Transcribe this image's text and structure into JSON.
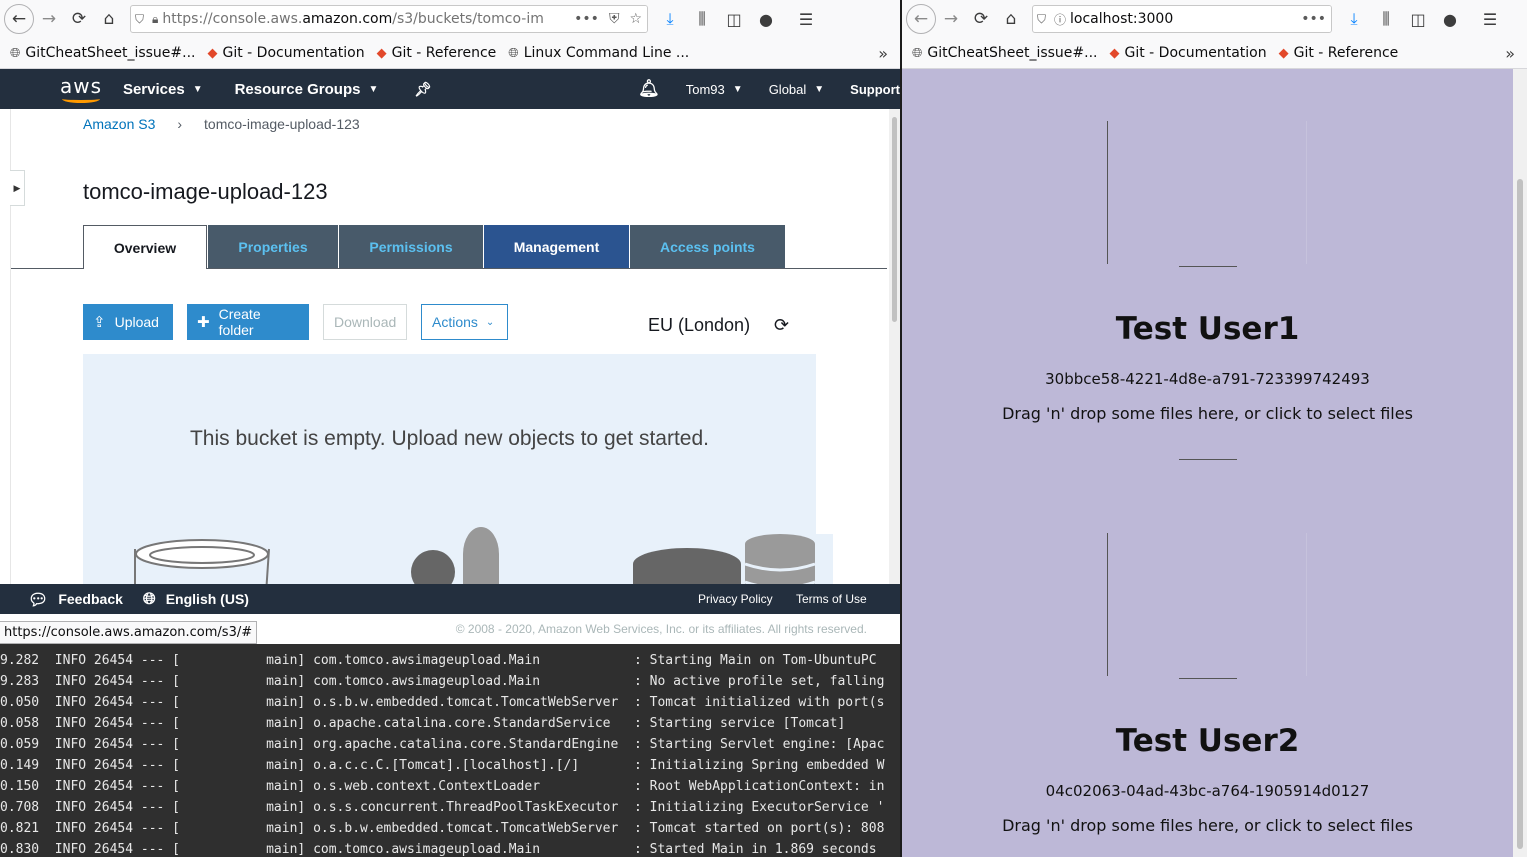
{
  "left_browser": {
    "url": {
      "prefix": "https://console.aws.",
      "host": "amazon.com",
      "path": "/s3/buckets/tomco-im"
    },
    "bookmarks": [
      {
        "icon": "globe-icon",
        "label": "GitCheatSheet_issue#..."
      },
      {
        "icon": "git-icon",
        "label": "Git - Documentation"
      },
      {
        "icon": "git-icon",
        "label": "Git - Reference"
      },
      {
        "icon": "globe-icon",
        "label": "Linux Command Line ..."
      }
    ],
    "status_url": "https://console.aws.amazon.com/s3/#"
  },
  "aws": {
    "logo": "aws",
    "nav": {
      "services": "Services",
      "resource_groups": "Resource Groups",
      "user": "Tom93",
      "region": "Global",
      "support": "Support"
    },
    "breadcrumb": {
      "root": "Amazon S3",
      "current": "tomco-image-upload-123"
    },
    "bucket_title": "tomco-image-upload-123",
    "tabs": [
      {
        "label": "Overview",
        "active": true
      },
      {
        "label": "Properties"
      },
      {
        "label": "Permissions"
      },
      {
        "label": "Management"
      },
      {
        "label": "Access points"
      }
    ],
    "buttons": {
      "upload": "Upload",
      "create_folder": "Create folder",
      "download": "Download",
      "actions": "Actions"
    },
    "region_label": "EU (London)",
    "empty_message": "This bucket is empty. Upload new objects to get started.",
    "footer": {
      "feedback": "Feedback",
      "language": "English (US)",
      "privacy": "Privacy Policy",
      "terms": "Terms of Use",
      "copyright": "© 2008 - 2020, Amazon Web Services, Inc. or its affiliates. All rights reserved."
    },
    "colors": {
      "nav_bg": "#232f3e",
      "accent": "#2e8bcc",
      "tab_bg": "#485a6a",
      "tab_mgmt": "#2b5490"
    }
  },
  "terminal": {
    "lines": [
      "9.282  INFO 26454 --- [           main] com.tomco.awsimageupload.Main            : Starting Main on Tom-UbuntuPC",
      "9.283  INFO 26454 --- [           main] com.tomco.awsimageupload.Main            : No active profile set, falling",
      "0.050  INFO 26454 --- [           main] o.s.b.w.embedded.tomcat.TomcatWebServer  : Tomcat initialized with port(s",
      "0.058  INFO 26454 --- [           main] o.apache.catalina.core.StandardService   : Starting service [Tomcat]",
      "0.059  INFO 26454 --- [           main] org.apache.catalina.core.StandardEngine  : Starting Servlet engine: [Apac",
      "0.149  INFO 26454 --- [           main] o.a.c.c.C.[Tomcat].[localhost].[/]       : Initializing Spring embedded W",
      "0.150  INFO 26454 --- [           main] o.s.web.context.ContextLoader            : Root WebApplicationContext: in",
      "0.708  INFO 26454 --- [           main] o.s.s.concurrent.ThreadPoolTaskExecutor  : Initializing ExecutorService '",
      "0.821  INFO 26454 --- [           main] o.s.b.w.embedded.tomcat.TomcatWebServer  : Tomcat started on port(s): 808",
      "0.830  INFO 26454 --- [           main] com.tomco.awsimageupload.Main            : Started Main in 1.869 seconds"
    ]
  },
  "right_browser": {
    "url": "localhost:3000",
    "bookmarks": [
      {
        "icon": "globe-icon",
        "label": "GitCheatSheet_issue#..."
      },
      {
        "icon": "git-icon",
        "label": "Git - Documentation"
      },
      {
        "icon": "git-icon",
        "label": "Git - Reference"
      }
    ]
  },
  "app": {
    "background": "#bdb8d7",
    "users": [
      {
        "name": "Test User1",
        "id": "30bbce58-4221-4d8e-a791-723399742493",
        "dropzone": "Drag 'n' drop some files here, or click to select files"
      },
      {
        "name": "Test User2",
        "id": "04c02063-04ad-43bc-a764-1905914d0127",
        "dropzone": "Drag 'n' drop some files here, or click to select files"
      }
    ]
  }
}
